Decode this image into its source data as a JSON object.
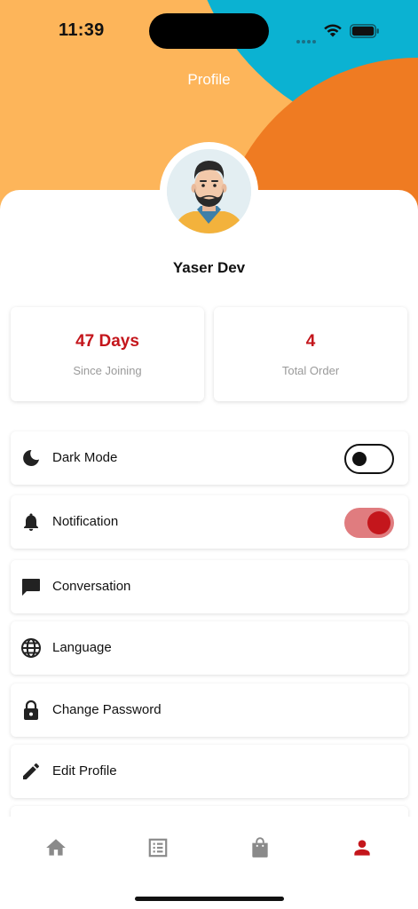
{
  "status_bar": {
    "time": "11:39"
  },
  "header": {
    "title": "Profile"
  },
  "profile": {
    "name": "Yaser Dev"
  },
  "stats": [
    {
      "value": "47 Days",
      "label": "Since Joining"
    },
    {
      "value": "4",
      "label": "Total Order"
    }
  ],
  "menu": {
    "dark_mode": {
      "label": "Dark Mode",
      "icon": "moon-icon",
      "toggle_on": false
    },
    "notification": {
      "label": "Notification",
      "icon": "bell-icon",
      "toggle_on": true
    },
    "conversation": {
      "label": "Conversation",
      "icon": "chat-icon"
    },
    "language": {
      "label": "Language",
      "icon": "globe-icon"
    },
    "change_password": {
      "label": "Change Password",
      "icon": "lock-icon"
    },
    "edit_profile": {
      "label": "Edit Profile",
      "icon": "pencil-icon"
    }
  },
  "bottom_nav": {
    "items": [
      "home-icon",
      "orders-list-icon",
      "shopping-bag-icon",
      "person-icon"
    ],
    "active": "person-icon"
  },
  "colors": {
    "accent": "#c4161c",
    "header_orange_light": "#fdb55a",
    "header_cyan": "#0bb2d2",
    "header_orange_dark": "#ef7b22",
    "icon_inactive": "#8a8a8a"
  }
}
